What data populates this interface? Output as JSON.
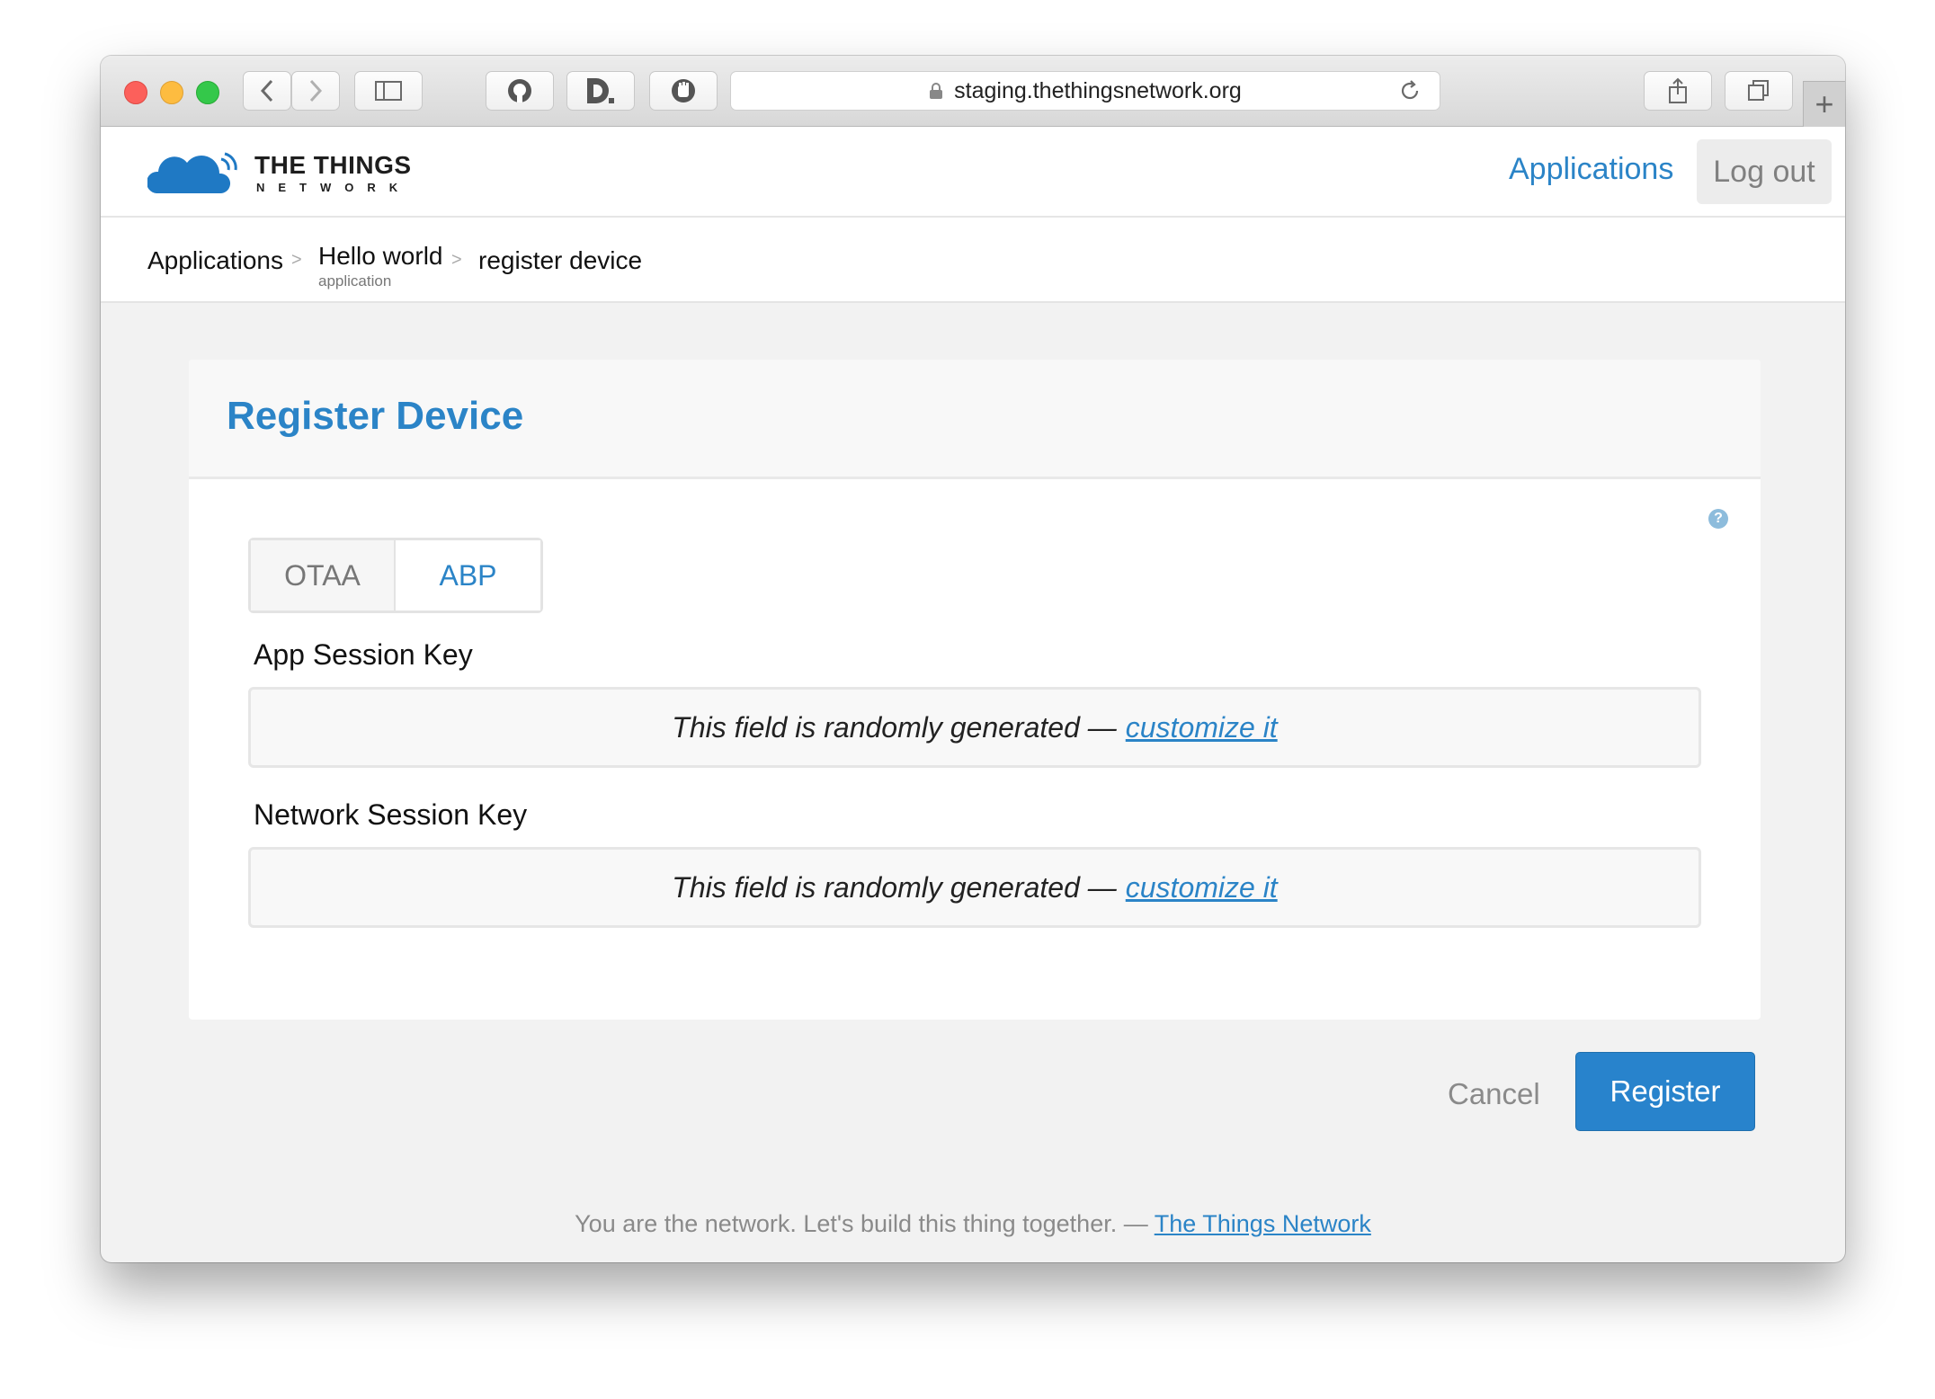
{
  "browser": {
    "url": "staging.thethingsnetwork.org",
    "new_tab_label": "+"
  },
  "header": {
    "logo_line1": "THE THINGS",
    "logo_line2": "NETWORK",
    "nav_applications": "Applications",
    "nav_logout": "Log out"
  },
  "breadcrumb": {
    "item1": "Applications",
    "item2": "Hello world",
    "item2_sub": "application",
    "item3": "register device",
    "separator": ">"
  },
  "card": {
    "title": "Register Device",
    "help": "?",
    "activation_methods": [
      "OTAA",
      "ABP"
    ],
    "selected_method": "ABP",
    "fields": [
      {
        "label": "App Session Key",
        "placeholder": "This field is randomly generated —",
        "link": "customize it"
      },
      {
        "label": "Network Session Key",
        "placeholder": "This field is randomly generated —",
        "link": "customize it"
      }
    ]
  },
  "actions": {
    "cancel": "Cancel",
    "register": "Register"
  },
  "footer": {
    "text": "You are the network. Let's build this thing together. —",
    "link": "The Things Network"
  },
  "colors": {
    "accent": "#2b84c7",
    "button": "#2883cc"
  }
}
